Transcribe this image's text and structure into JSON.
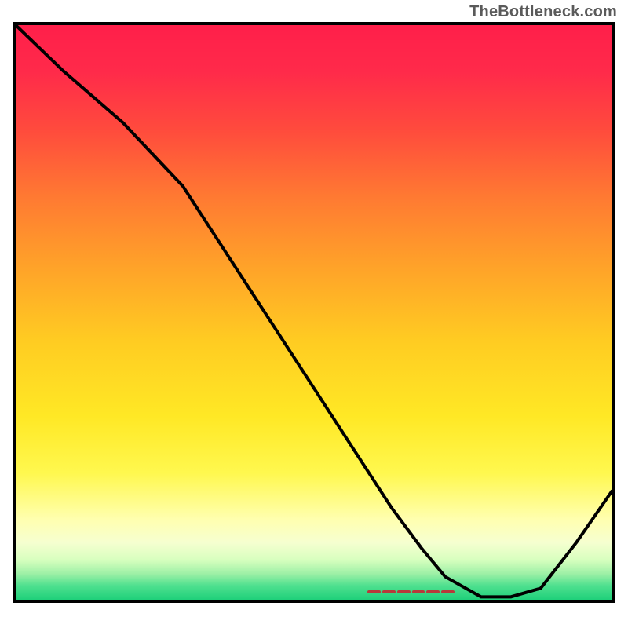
{
  "watermark": "TheBottleneck.com",
  "chart_data": {
    "type": "line",
    "title": "",
    "xlabel": "",
    "ylabel": "",
    "x_range": [
      0,
      100
    ],
    "y_range": [
      0,
      100
    ],
    "series": [
      {
        "name": "curve",
        "x": [
          0,
          8,
          18,
          28,
          38,
          48,
          58,
          63,
          68,
          72,
          78,
          83,
          88,
          94,
          100
        ],
        "y": [
          100,
          92,
          83,
          72,
          56,
          40,
          24,
          16,
          9,
          4,
          0.5,
          0.5,
          2,
          10,
          19
        ]
      }
    ],
    "baseline_highlight": {
      "x_start": 59,
      "x_end": 73.5,
      "color": "#b83a3a"
    },
    "background_gradient": {
      "stops": [
        {
          "pct": 0,
          "color": "#ff1f4a"
        },
        {
          "pct": 8,
          "color": "#ff2a4a"
        },
        {
          "pct": 18,
          "color": "#ff4a3d"
        },
        {
          "pct": 30,
          "color": "#ff7a32"
        },
        {
          "pct": 42,
          "color": "#ffa229"
        },
        {
          "pct": 55,
          "color": "#ffcc22"
        },
        {
          "pct": 68,
          "color": "#ffe825"
        },
        {
          "pct": 78,
          "color": "#fff84f"
        },
        {
          "pct": 86,
          "color": "#ffffb0"
        },
        {
          "pct": 90,
          "color": "#f6ffd0"
        },
        {
          "pct": 93,
          "color": "#d8ffbf"
        },
        {
          "pct": 95.5,
          "color": "#9df0a6"
        },
        {
          "pct": 97.5,
          "color": "#4fe08f"
        },
        {
          "pct": 100,
          "color": "#1fd07a"
        }
      ]
    }
  }
}
